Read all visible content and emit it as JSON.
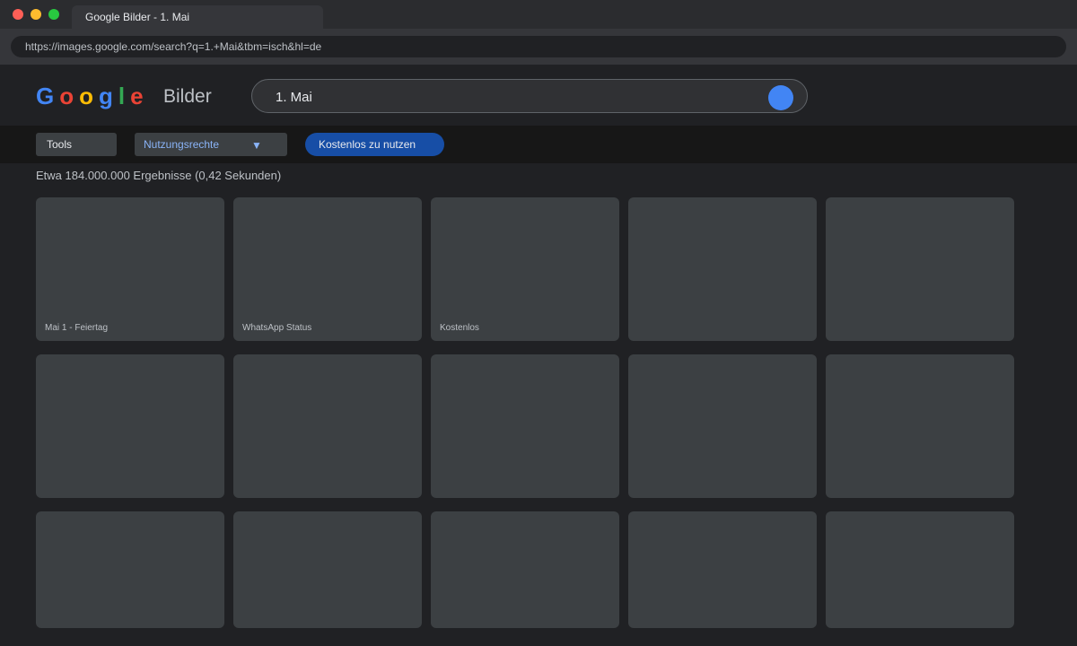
{
  "window": {
    "tab_title": "Google Bilder - 1. Mai",
    "url": "https://images.google.com/search?q=1.+Mai&tbm=isch&hl=de",
    "traffic_lights": {
      "close": "#ff5f57",
      "minimize": "#febc2e",
      "zoom": "#28c840"
    }
  },
  "logo": {
    "letters": [
      {
        "char": "G",
        "color": "#4285f4"
      },
      {
        "char": "o",
        "color": "#ea4335"
      },
      {
        "char": "o",
        "color": "#fbbc05"
      },
      {
        "char": "g",
        "color": "#4285f4"
      },
      {
        "char": "l",
        "color": "#34a853"
      },
      {
        "char": "e",
        "color": "#ea4335"
      }
    ],
    "suffix": "Bilder"
  },
  "search": {
    "query": "1. Mai",
    "button_icon": "search-icon",
    "button_color": "#4285f4"
  },
  "toolbar": {
    "tools_label": "Tools",
    "usage_rights_label": "Nutzungsrechte",
    "usage_rights_caret": "▼",
    "free_chip_label": "Kostenlos zu nutzen"
  },
  "results": {
    "count_text": "Etwa 184.000.000 Ergebnisse (0,42 Sekunden)",
    "tiles": [
      {
        "caption": "Mai 1 - Feiertag"
      },
      {
        "caption": "WhatsApp Status"
      },
      {
        "caption": "Kostenlos"
      },
      {
        "caption": ""
      },
      {
        "caption": ""
      },
      {
        "caption": ""
      },
      {
        "caption": ""
      },
      {
        "caption": ""
      },
      {
        "caption": ""
      },
      {
        "caption": ""
      },
      {
        "caption": ""
      },
      {
        "caption": ""
      },
      {
        "caption": ""
      },
      {
        "caption": ""
      },
      {
        "caption": ""
      }
    ]
  }
}
